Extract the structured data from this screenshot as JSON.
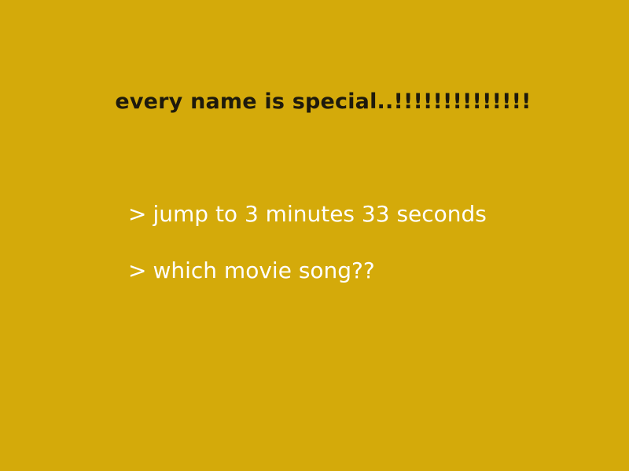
{
  "slide": {
    "title": "every name is special..!!!!!!!!!!!!!!",
    "bullet_marker": ">",
    "bullets": [
      "jump to 3 minutes 33 seconds",
      "which movie song??"
    ],
    "background_color": "#d4aa0a",
    "title_color": "#1e1a0c",
    "bullet_color": "#ffffff"
  }
}
